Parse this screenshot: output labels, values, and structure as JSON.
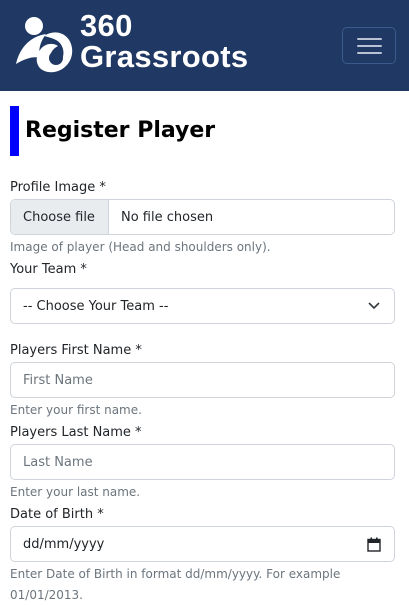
{
  "header": {
    "brand_line1": "360",
    "brand_line2": "Grassroots",
    "menu_icon": "hamburger-icon",
    "colors": {
      "navbar_bg": "#1f3864",
      "accent": "#0000ff"
    }
  },
  "page": {
    "title": "Register Player"
  },
  "form": {
    "profile_image": {
      "label": "Profile Image *",
      "button_label": "Choose file",
      "status": "No file chosen",
      "help": "Image of player (Head and shoulders only)."
    },
    "team": {
      "label": "Your Team *",
      "selected": "-- Choose Your Team --",
      "icon": "chevron-down-icon"
    },
    "first_name": {
      "label": "Players First Name *",
      "placeholder": "First Name",
      "help": "Enter your first name."
    },
    "last_name": {
      "label": "Players Last Name *",
      "placeholder": "Last Name",
      "help": "Enter your last name."
    },
    "dob": {
      "label": "Date of Birth *",
      "placeholder": "dd/mm/yyyy",
      "icon": "calendar-icon",
      "help": "Enter Date of Birth in format dd/mm/yyyy. For example 01/01/2013."
    }
  }
}
